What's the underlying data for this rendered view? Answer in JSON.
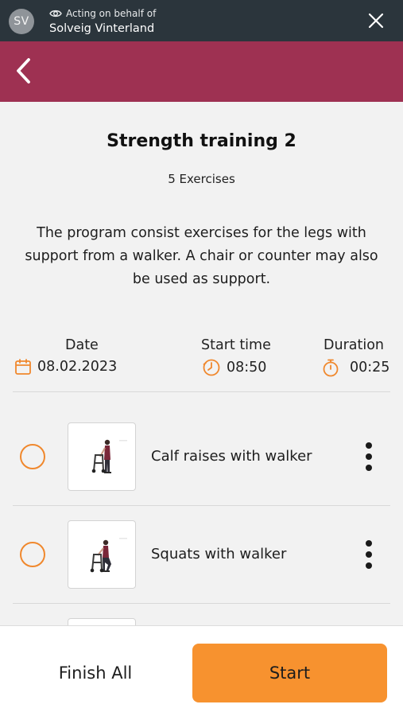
{
  "status_bar": {
    "avatar_initials": "SV",
    "acting_label": "Acting on behalf of",
    "acting_name": "Solveig Vinterland",
    "icons": [
      "eye-icon",
      "close-icon"
    ]
  },
  "header": {
    "color": "#9e3152",
    "icons": [
      "chevron-left-icon"
    ]
  },
  "program": {
    "title": "Strength training 2",
    "exercise_count": "5 Exercises",
    "description": "The program consist exercises for the legs with support from a walker. A chair or counter may also be used as support."
  },
  "schedule": {
    "date_label": "Date",
    "date_value": "08.02.2023",
    "start_label": "Start time",
    "start_value": "08:50",
    "duration_label": "Duration",
    "duration_value": "00:25",
    "accent": "#f0882d"
  },
  "exercises": [
    {
      "name": "Calf raises with walker",
      "done": false
    },
    {
      "name": "Squats with walker",
      "done": false
    }
  ],
  "actions": {
    "finish_label": "Finish All",
    "start_label": "Start",
    "start_color": "#f7922f"
  }
}
